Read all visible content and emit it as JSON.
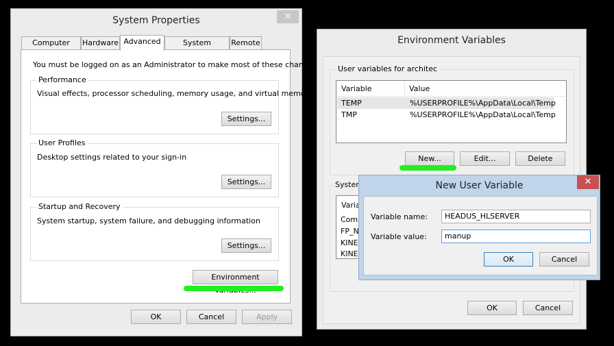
{
  "system_properties": {
    "title": "System Properties",
    "tabs": [
      "Computer Name",
      "Hardware",
      "Advanced",
      "System Protection",
      "Remote"
    ],
    "active_tab": "Advanced",
    "admin_notice": "You must be logged on as an Administrator to make most of these changes.",
    "groups": [
      {
        "label": "Performance",
        "desc": "Visual effects, processor scheduling, memory usage, and virtual memory",
        "button": "Settings..."
      },
      {
        "label": "User Profiles",
        "desc": "Desktop settings related to your sign-in",
        "button": "Settings..."
      },
      {
        "label": "Startup and Recovery",
        "desc": "System startup, system failure, and debugging information",
        "button": "Settings..."
      }
    ],
    "env_button": "Environment Variables...",
    "ok": "OK",
    "cancel": "Cancel",
    "apply": "Apply"
  },
  "env_vars": {
    "title": "Environment Variables",
    "user_group_label": "User variables for architec",
    "columns": [
      "Variable",
      "Value"
    ],
    "user_rows": [
      {
        "name": "TEMP",
        "value": "%USERPROFILE%\\AppData\\Local\\Temp"
      },
      {
        "name": "TMP",
        "value": "%USERPROFILE%\\AppData\\Local\\Temp"
      }
    ],
    "new": "New...",
    "edit": "Edit...",
    "delete": "Delete",
    "system_group_label": "System",
    "system_header": "Varial",
    "system_rows": [
      "ComS",
      "FP_N",
      "KINE(",
      "KINE("
    ],
    "ok": "OK",
    "cancel": "Cancel"
  },
  "new_user_variable": {
    "title": "New User Variable",
    "name_label": "Variable name:",
    "name_value": "HEADUS_HLSERVER",
    "value_label": "Variable value:",
    "value_value": "manup",
    "ok": "OK",
    "cancel": "Cancel"
  },
  "highlight_color": "#22ee22"
}
